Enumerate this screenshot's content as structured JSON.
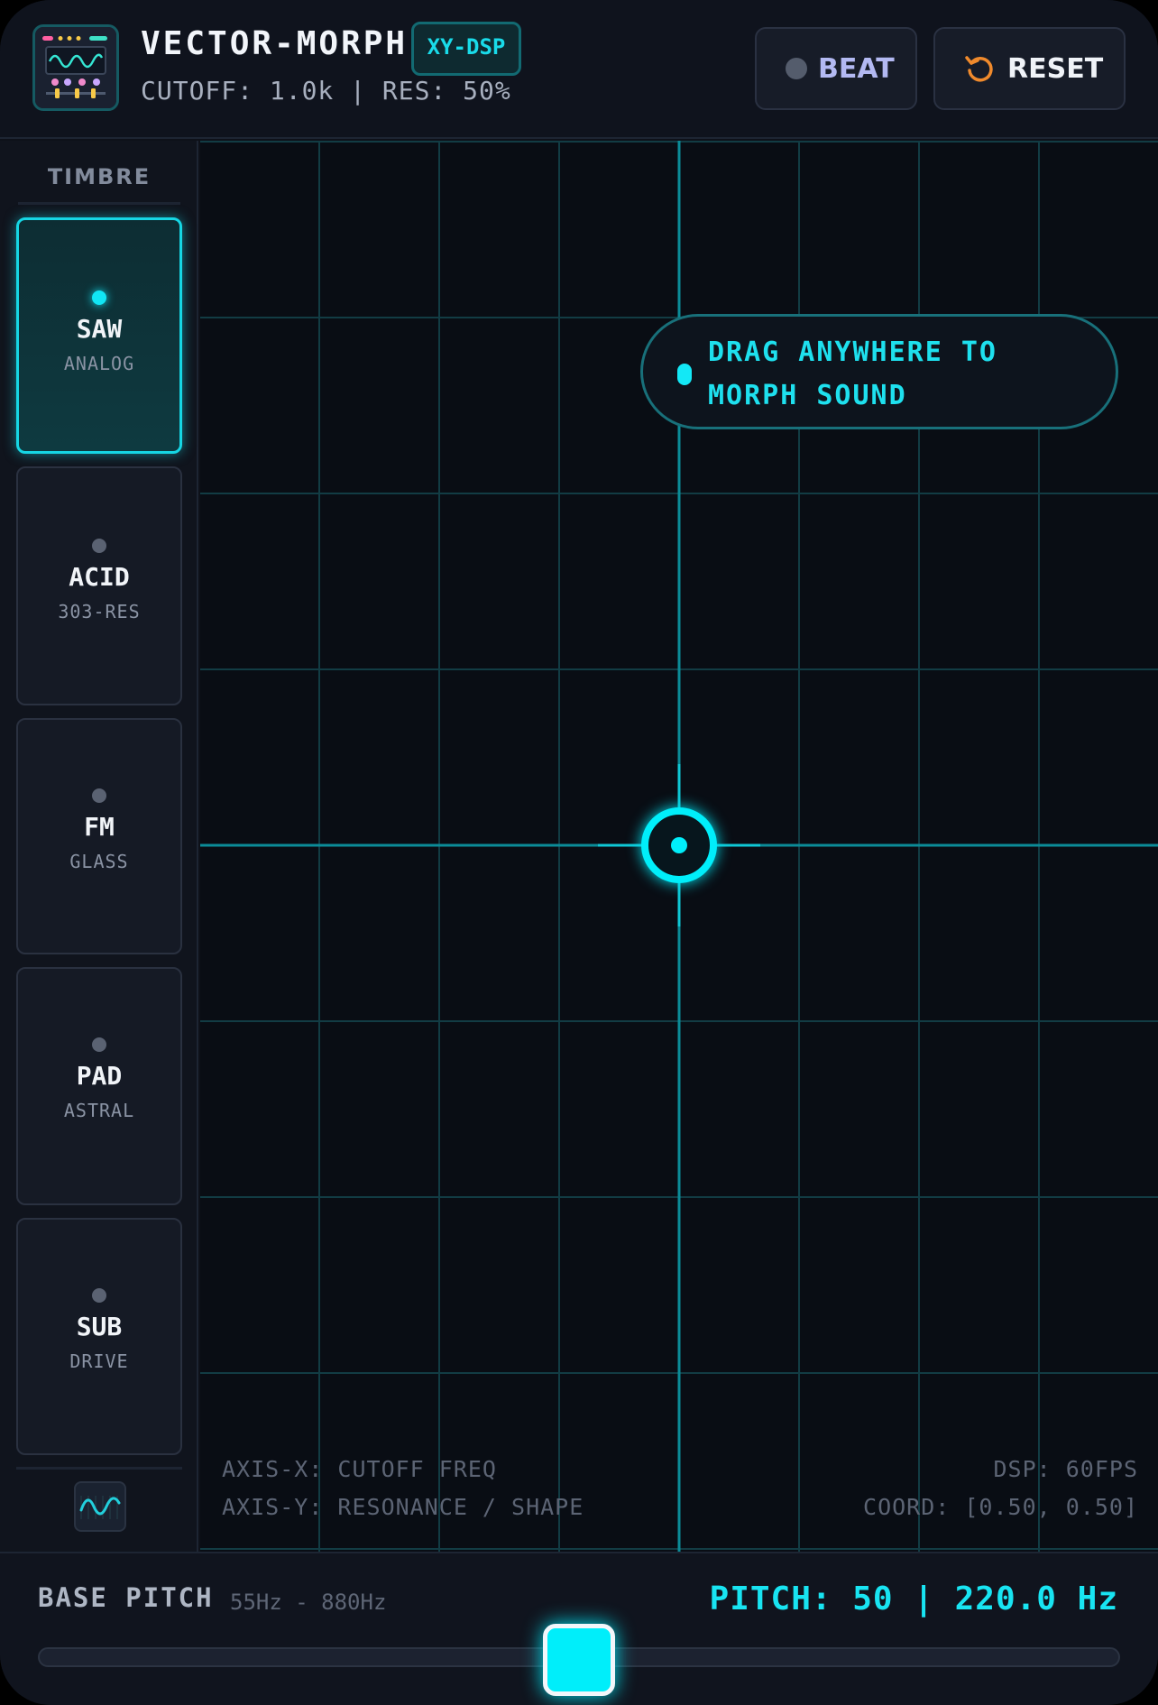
{
  "header": {
    "app_title": "VECTOR-MORPH",
    "mode_tag": "XY-DSP",
    "status_line": "CUTOFF: 1.0k | RES: 50%",
    "beat_label": "BEAT",
    "reset_label": "RESET"
  },
  "sidebar": {
    "title": "TIMBRE",
    "items": [
      {
        "name": "SAW",
        "sub": "ANALOG",
        "active": true
      },
      {
        "name": "ACID",
        "sub": "303-RES",
        "active": false
      },
      {
        "name": "FM",
        "sub": "GLASS",
        "active": false
      },
      {
        "name": "PAD",
        "sub": "ASTRAL",
        "active": false
      },
      {
        "name": "SUB",
        "sub": "DRIVE",
        "active": false
      }
    ]
  },
  "pad": {
    "hint": "DRAG ANYWHERE TO MORPH SOUND",
    "axis_x": "AXIS-X: CUTOFF FREQ",
    "axis_y": "AXIS-Y: RESONANCE / SHAPE",
    "dsp_rate": "DSP: 60FPS",
    "coord": "COORD: [0.50, 0.50]",
    "cursor_x": 0.5,
    "cursor_y": 0.5
  },
  "pitch": {
    "label": "BASE PITCH",
    "range": "55Hz - 880Hz",
    "readout": "PITCH: 50 | 220.0 Hz",
    "value_fraction": 0.5
  },
  "colors": {
    "accent": "#00eefa",
    "reset_icon": "#f08a2c",
    "beat_text": "#b3b9f2"
  },
  "icons": {
    "logo": "synth-panel-icon",
    "beat": "beat-dot-icon",
    "reset": "reset-arrow-icon",
    "wave": "sine-wave-icon",
    "cursor": "crosshair-icon"
  }
}
